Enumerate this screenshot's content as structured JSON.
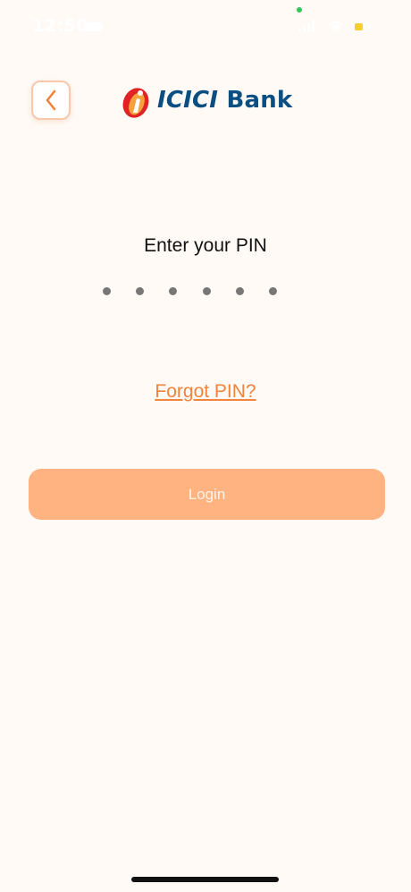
{
  "status_bar": {
    "time": "12:50",
    "icons": [
      "signal-icon",
      "wifi-icon",
      "battery-icon"
    ]
  },
  "header": {
    "back_icon": "chevron-left-icon",
    "logo": {
      "name": "ICICI",
      "suffix": "Bank"
    }
  },
  "pin": {
    "title": "Enter your PIN",
    "length": 6,
    "filled": 0
  },
  "forgot_label": "Forgot PIN?",
  "login_label": "Login",
  "colors": {
    "background": "#FFFAF6",
    "accent": "#F0843C",
    "button_disabled": "#FFB380",
    "logo_blue": "#0B4F82",
    "logo_red": "#E02426"
  }
}
